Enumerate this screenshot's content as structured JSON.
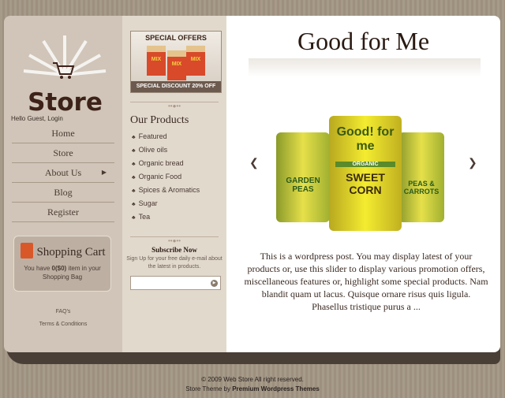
{
  "logo": {
    "text": "Store"
  },
  "user": {
    "greeting": "Hello Guest, Login"
  },
  "nav": [
    {
      "label": "Home"
    },
    {
      "label": "Store"
    },
    {
      "label": "About Us",
      "submenu_icon": "triangle-right"
    },
    {
      "label": "Blog"
    },
    {
      "label": "Register"
    }
  ],
  "cart": {
    "title": "Shopping Cart",
    "text_prefix": "You have ",
    "count": "0($0)",
    "text_suffix": " item in your Shopping Bag"
  },
  "footer_links": [
    "FAQ's",
    "Terms & Conditions"
  ],
  "offer": {
    "title": "SPECIAL OFFERS",
    "banner": "SPECIAL DISCOUNT 20% OFF",
    "product_label": "MIX"
  },
  "products": {
    "title": "Our Products",
    "items": [
      "Featured",
      "Olive oils",
      "Organic bread",
      "Organic Food",
      "Spices & Aromatics",
      "Sugar",
      "Tea"
    ]
  },
  "subscribe": {
    "title": "Subscribe Now",
    "text": "Sign Up for your free daily e-mail about the latest in products.",
    "value": ""
  },
  "main": {
    "title": "Good for Me",
    "slides": [
      "GARDEN PEAS",
      "SWEET CORN",
      "PEAS & CARROTS"
    ],
    "brand": "Good! for me",
    "badge": "ORGANIC",
    "description": "This is a wordpress post. You may display latest of your products or, use this slider to display various promotion offers, miscellaneous features or, highlight some special products. Nam blandit quam ut lacus. Quisque ornare risus quis ligula. Phasellus tristique purus a ..."
  },
  "footer": {
    "copyright": "© 2009 Web Store All right reserved.",
    "theme_prefix": "Store Theme by ",
    "theme_link": "Premium Wordpress Themes"
  }
}
